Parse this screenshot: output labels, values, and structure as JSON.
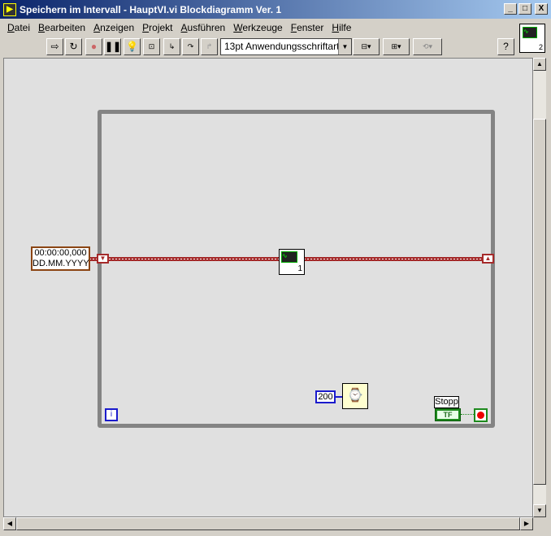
{
  "window": {
    "title": "Speichern im Intervall - HauptVI.vi Blockdiagramm Ver. 1",
    "minimize": "_",
    "maximize": "□",
    "close": "X"
  },
  "menu": [
    "Datei",
    "Bearbeiten",
    "Anzeigen",
    "Projekt",
    "Ausführen",
    "Werkzeuge",
    "Fenster",
    "Hilfe"
  ],
  "toolbar": {
    "font": "13pt Anwendungsschriftart",
    "help": "?"
  },
  "connector_pane": {
    "number": "2"
  },
  "diagram": {
    "timestamp_constant": {
      "line1": "00:00:00,000",
      "line2": "DD.MM.YYYY"
    },
    "subvi": {
      "number": "1"
    },
    "wait_ms": "200",
    "iteration_terminal": "i",
    "stop_label": "Stopp",
    "stop_terminal": "TF"
  }
}
